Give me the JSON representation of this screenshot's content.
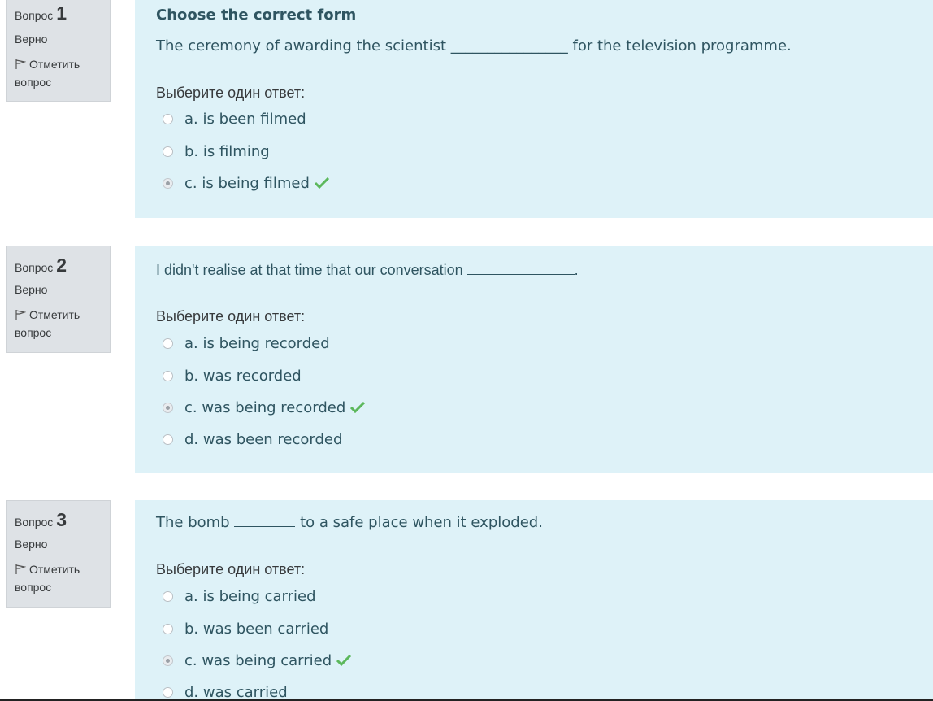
{
  "colors": {
    "info_background": "#dee2e6",
    "content_background": "#def2f8",
    "correct_check": "#5cb85c",
    "text": "#2f5561"
  },
  "icons": {
    "flag": "flag-icon",
    "correct": "check-icon"
  },
  "questions": [
    {
      "label": "Вопрос",
      "number": "1",
      "state": "Верно",
      "flag_label": "Отметить вопрос",
      "title": "Choose the correct form",
      "text_before": "The ceremony of awarding the scientist",
      "blank": "________________",
      "text_after": "for  the television programme.",
      "prompt": "Выберите один ответ:",
      "options": [
        {
          "label": "a. is been filmed",
          "checked": false,
          "correct": false
        },
        {
          "label": "b. is filming",
          "checked": false,
          "correct": false
        },
        {
          "label": "c. is being filmed",
          "checked": true,
          "correct": true
        }
      ]
    },
    {
      "label": "Вопрос",
      "number": "2",
      "state": "Верно",
      "flag_label": "Отметить вопрос",
      "text_before": "I didn't realise at that time that our conversation",
      "text_after": ".",
      "prompt": "Выберите один ответ:",
      "options": [
        {
          "label": "a. is being recorded",
          "checked": false,
          "correct": false
        },
        {
          "label": "b. was recorded",
          "checked": false,
          "correct": false
        },
        {
          "label": "c. was being recorded",
          "checked": true,
          "correct": true
        },
        {
          "label": "d. was been recorded",
          "checked": false,
          "correct": false
        }
      ]
    },
    {
      "label": "Вопрос",
      "number": "3",
      "state": "Верно",
      "flag_label": "Отметить вопрос",
      "text_before": "The bomb",
      "text_after": "to a safe place when it exploded.",
      "prompt": "Выберите один ответ:",
      "options": [
        {
          "label": "a. is being carried",
          "checked": false,
          "correct": false
        },
        {
          "label": "b. was been carried",
          "checked": false,
          "correct": false
        },
        {
          "label": "c. was being carried",
          "checked": true,
          "correct": true
        },
        {
          "label": "d. was carried",
          "checked": false,
          "correct": false
        }
      ]
    }
  ]
}
